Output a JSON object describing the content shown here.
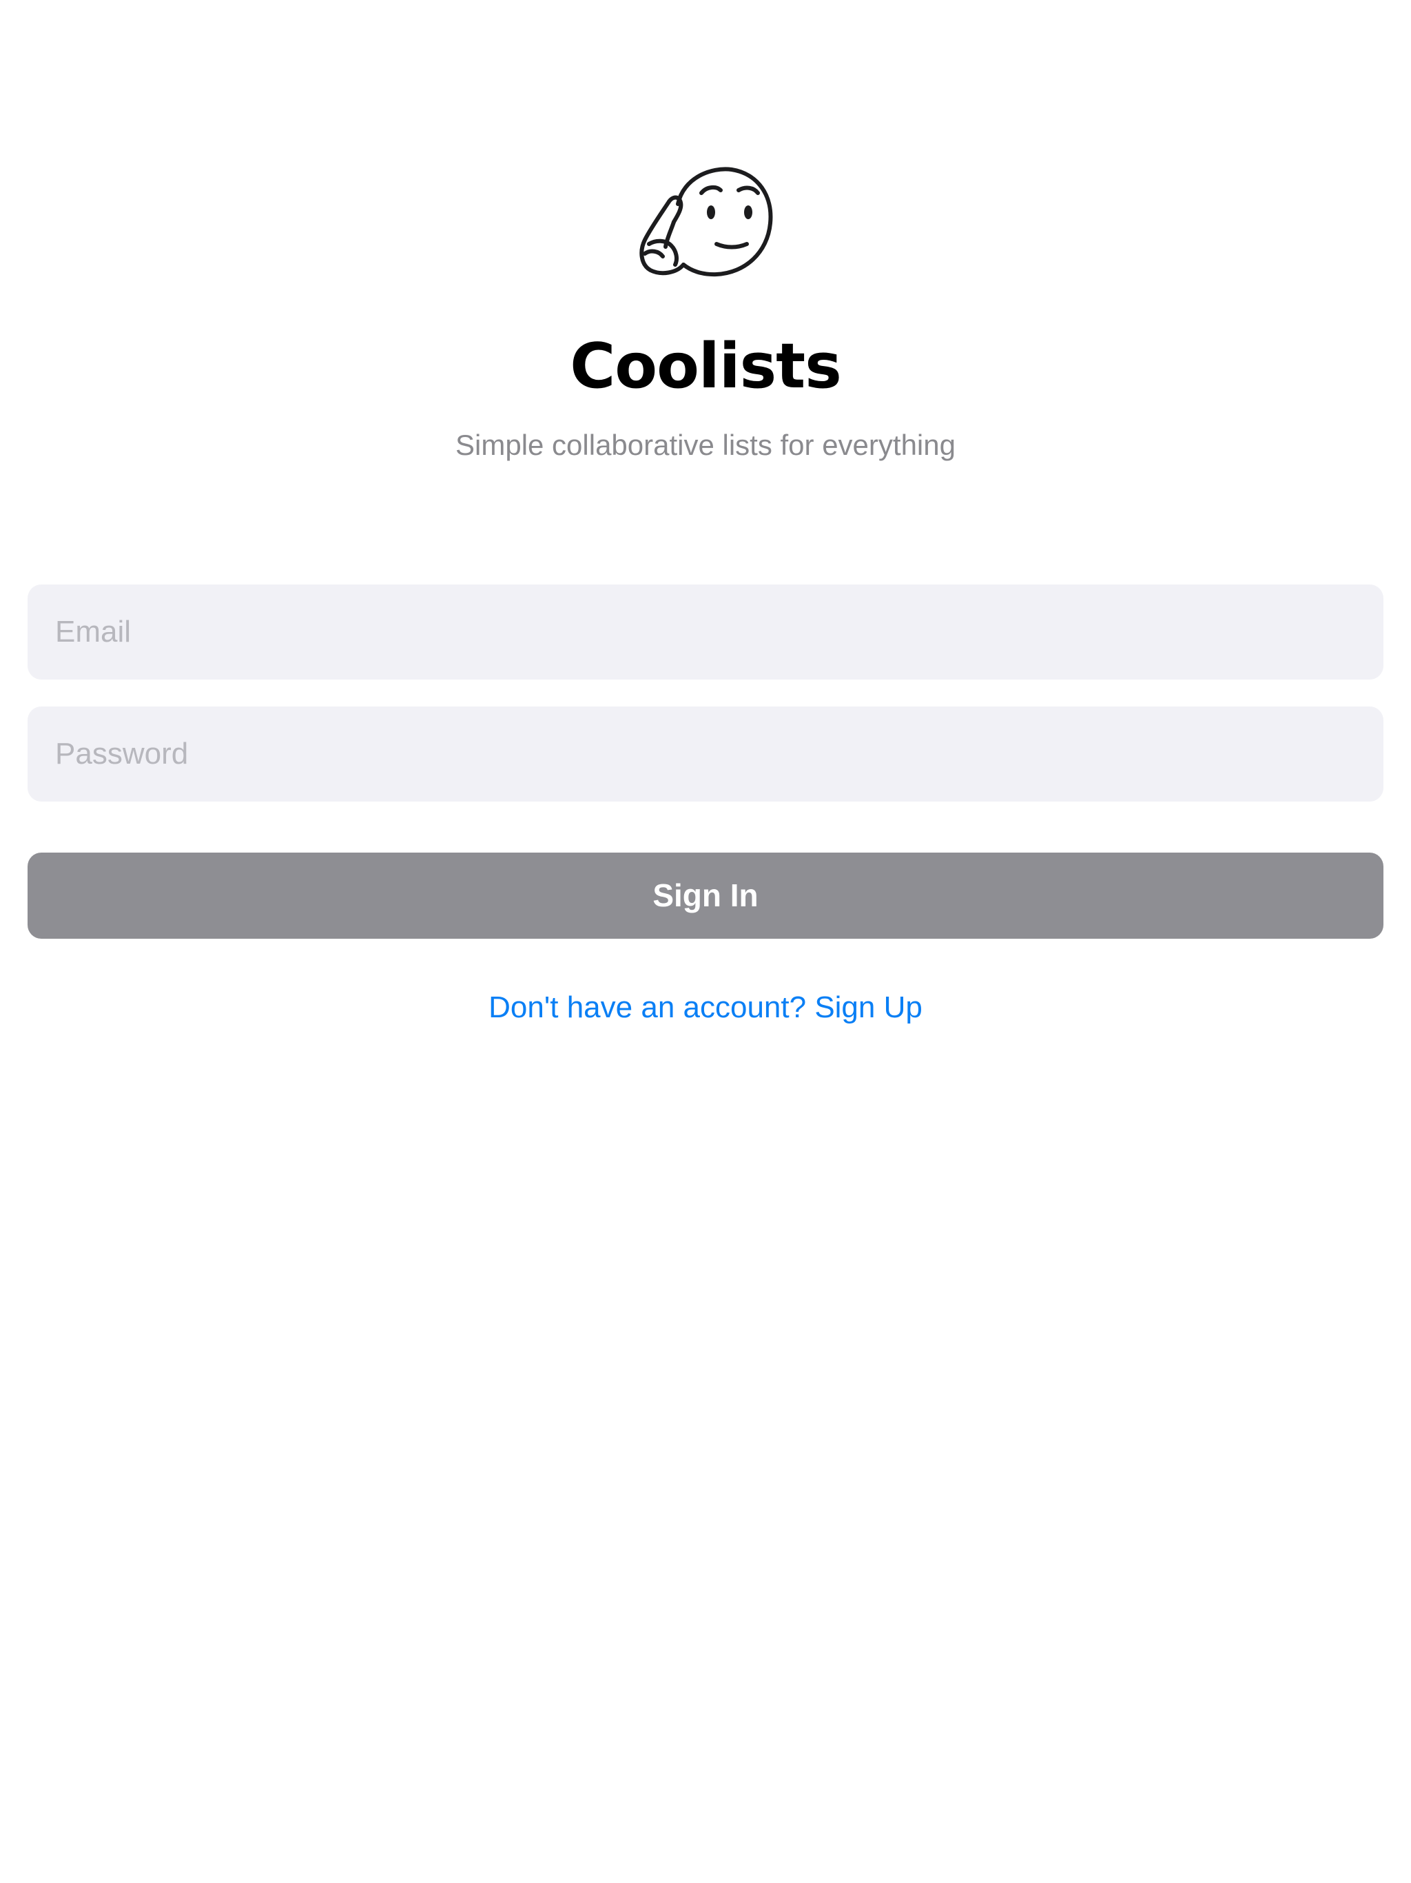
{
  "app": {
    "logo_icon": "thinking-face-icon",
    "title": "Coolists",
    "subtitle": "Simple collaborative lists for everything"
  },
  "form": {
    "email_placeholder": "Email",
    "email_value": "",
    "password_placeholder": "Password",
    "password_value": "",
    "signin_label": "Sign In",
    "signup_link": "Don't have an account? Sign Up"
  },
  "colors": {
    "field_background": "#f1f1f6",
    "button_disabled": "#8e8e93",
    "link": "#0a7ff5",
    "subtitle": "#8a8a8e"
  }
}
